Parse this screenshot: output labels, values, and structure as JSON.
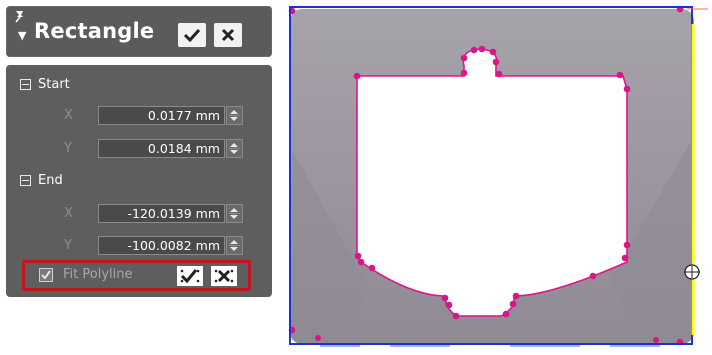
{
  "command": {
    "title": "Rectangle",
    "ok_icon": "checkmark-icon",
    "cancel_icon": "x-icon"
  },
  "start": {
    "header": "Start",
    "x_label": "X",
    "x_value": "0.0177 mm",
    "y_label": "Y",
    "y_value": "0.0184 mm"
  },
  "end": {
    "header": "End",
    "x_label": "X",
    "x_value": "-120.0139 mm",
    "y_label": "Y",
    "y_value": "-100.0082 mm"
  },
  "fit_polyline": {
    "label": "Fit Polyline",
    "checked": true
  },
  "colors": {
    "selection_box": "#1f2fd8",
    "polyline": "#e0148f",
    "part_fill": "#9d98a0",
    "edge_highlight": "#ffff00",
    "highlight_border": "#c0161c"
  }
}
